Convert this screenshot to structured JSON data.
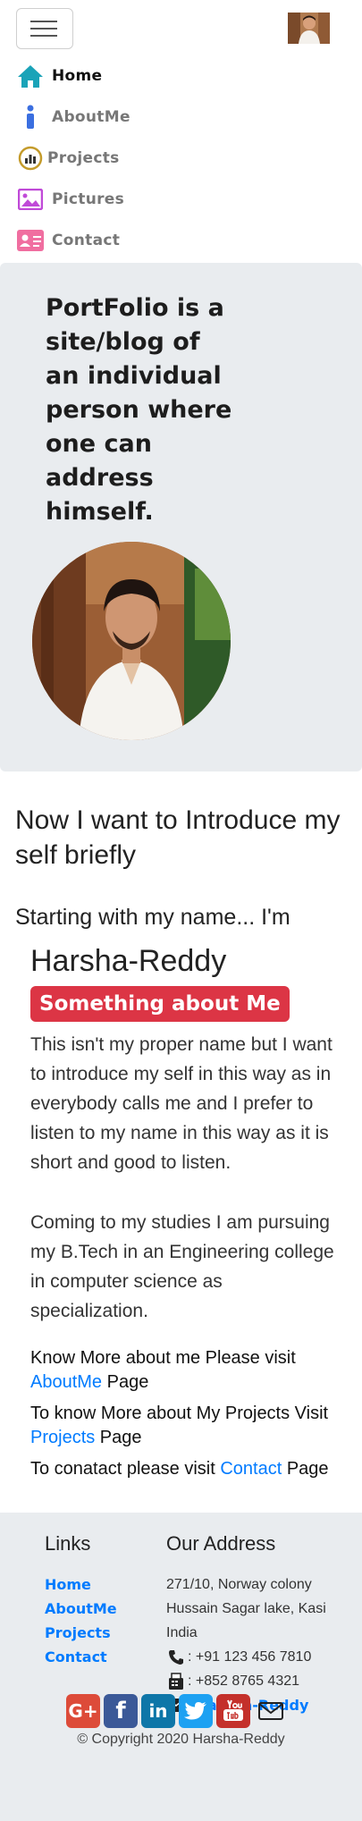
{
  "nav": {
    "items": [
      {
        "label": "Home",
        "icon": "home-icon"
      },
      {
        "label": "AboutMe",
        "icon": "info-icon"
      },
      {
        "label": "Projects",
        "icon": "projects-icon"
      },
      {
        "label": "Pictures",
        "icon": "picture-icon"
      },
      {
        "label": "Contact",
        "icon": "contact-card-icon"
      }
    ]
  },
  "hero": {
    "heading": "PortFolio is a site/blog of an individual person where one can address himself."
  },
  "about": {
    "intro": "Now I want to Introduce my self briefly",
    "starting": "Starting with my name... I'm",
    "name": "Harsha-Reddy",
    "badge": "Something about Me",
    "para1": "This isn't my proper name but I want to introduce my self in this way as in everybody calls me and I prefer to listen to my name in this way as it is short and good to listen.",
    "para2": "Coming to my studies I am pursuing my B.Tech in an Engineering college in computer science as specialization.",
    "know1_pre": "Know More about me Please visit ",
    "know1_link": "AboutMe",
    "know1_post": " Page",
    "know2_pre": "To know More about My Projects Visit ",
    "know2_link": "Projects",
    "know2_post": " Page",
    "know3_pre": "To conatact please visit ",
    "know3_link": "Contact",
    "know3_post": " Page"
  },
  "footer": {
    "links_heading": "Links",
    "links": [
      "Home",
      "AboutMe",
      "Projects",
      "Contact"
    ],
    "address_heading": "Our Address",
    "address": "271/10, Norway colony Hussain Sagar lake, Kasi India",
    "phone": ": +91 123 456 7810",
    "fax": ": +852 8765 4321",
    "email_sep": ":",
    "email": "Harsha-Reddy",
    "social": [
      {
        "label": "G+",
        "icon": "google-plus-icon",
        "color": "#dd4b39"
      },
      {
        "label": "f",
        "icon": "facebook-icon",
        "color": "#3b5998"
      },
      {
        "label": "in",
        "icon": "linkedin-icon",
        "color": "#0e76a8"
      },
      {
        "label": "",
        "icon": "twitter-icon",
        "color": "#1da1f2"
      },
      {
        "label": "",
        "icon": "youtube-icon",
        "color": "#c4302b"
      },
      {
        "label": "",
        "icon": "mail-icon",
        "color": "#222222"
      }
    ],
    "copyright": "© Copyright 2020 Harsha-Reddy"
  }
}
